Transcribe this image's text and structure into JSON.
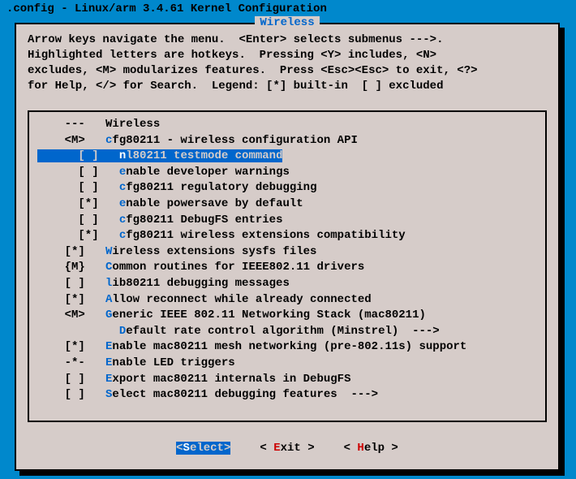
{
  "title": ".config - Linux/arm 3.4.61 Kernel Configuration",
  "dialog_title": "Wireless",
  "help_lines": [
    "Arrow keys navigate the menu.  <Enter> selects submenus --->.",
    "Highlighted letters are hotkeys.  Pressing <Y> includes, <N>",
    "excludes, <M> modularizes features.  Press <Esc><Esc> to exit, <?>",
    "for Help, </> for Search.  Legend: [*] built-in  [ ] excluded"
  ],
  "items": [
    {
      "indent": 0,
      "mark": "---",
      "hot": "",
      "text": "Wireless",
      "selected": false
    },
    {
      "indent": 0,
      "mark": "<M>",
      "hot": "c",
      "text": "fg80211 - wireless configuration API",
      "selected": false
    },
    {
      "indent": 1,
      "mark": "[ ]",
      "hot": "n",
      "text": "l80211 testmode command",
      "selected": true
    },
    {
      "indent": 1,
      "mark": "[ ]",
      "hot": "e",
      "text": "nable developer warnings",
      "selected": false
    },
    {
      "indent": 1,
      "mark": "[ ]",
      "hot": "c",
      "text": "fg80211 regulatory debugging",
      "selected": false
    },
    {
      "indent": 1,
      "mark": "[*]",
      "hot": "e",
      "text": "nable powersave by default",
      "selected": false
    },
    {
      "indent": 1,
      "mark": "[ ]",
      "hot": "c",
      "text": "fg80211 DebugFS entries",
      "selected": false
    },
    {
      "indent": 1,
      "mark": "[*]",
      "hot": "c",
      "text": "fg80211 wireless extensions compatibility",
      "selected": false
    },
    {
      "indent": 0,
      "mark": "[*]",
      "hot": "W",
      "text": "ireless extensions sysfs files",
      "selected": false
    },
    {
      "indent": 0,
      "mark": "{M}",
      "hot": "C",
      "text": "ommon routines for IEEE802.11 drivers",
      "selected": false
    },
    {
      "indent": 0,
      "mark": "[ ]",
      "hot": "l",
      "text": "ib80211 debugging messages",
      "selected": false
    },
    {
      "indent": 0,
      "mark": "[*]",
      "hot": "A",
      "text": "llow reconnect while already connected",
      "selected": false
    },
    {
      "indent": 0,
      "mark": "<M>",
      "hot": "G",
      "text": "eneric IEEE 802.11 Networking Stack (mac80211)",
      "selected": false
    },
    {
      "indent": 1,
      "mark": "   ",
      "hot": "D",
      "text": "efault rate control algorithm (Minstrel)  --->",
      "selected": false
    },
    {
      "indent": 0,
      "mark": "[*]",
      "hot": "E",
      "text": "nable mac80211 mesh networking (pre-802.11s) support",
      "selected": false
    },
    {
      "indent": 0,
      "mark": "-*-",
      "hot": "E",
      "text": "nable LED triggers",
      "selected": false
    },
    {
      "indent": 0,
      "mark": "[ ]",
      "hot": "E",
      "text": "xport mac80211 internals in DebugFS",
      "selected": false
    },
    {
      "indent": 0,
      "mark": "[ ]",
      "hot": "S",
      "text": "elect mac80211 debugging features  --->",
      "selected": false
    }
  ],
  "buttons": [
    {
      "pre": "<",
      "hot": "S",
      "post": "elect>",
      "selected": true
    },
    {
      "pre": "< ",
      "hot": "E",
      "post": "xit >",
      "selected": false
    },
    {
      "pre": "< ",
      "hot": "H",
      "post": "elp >",
      "selected": false
    }
  ]
}
